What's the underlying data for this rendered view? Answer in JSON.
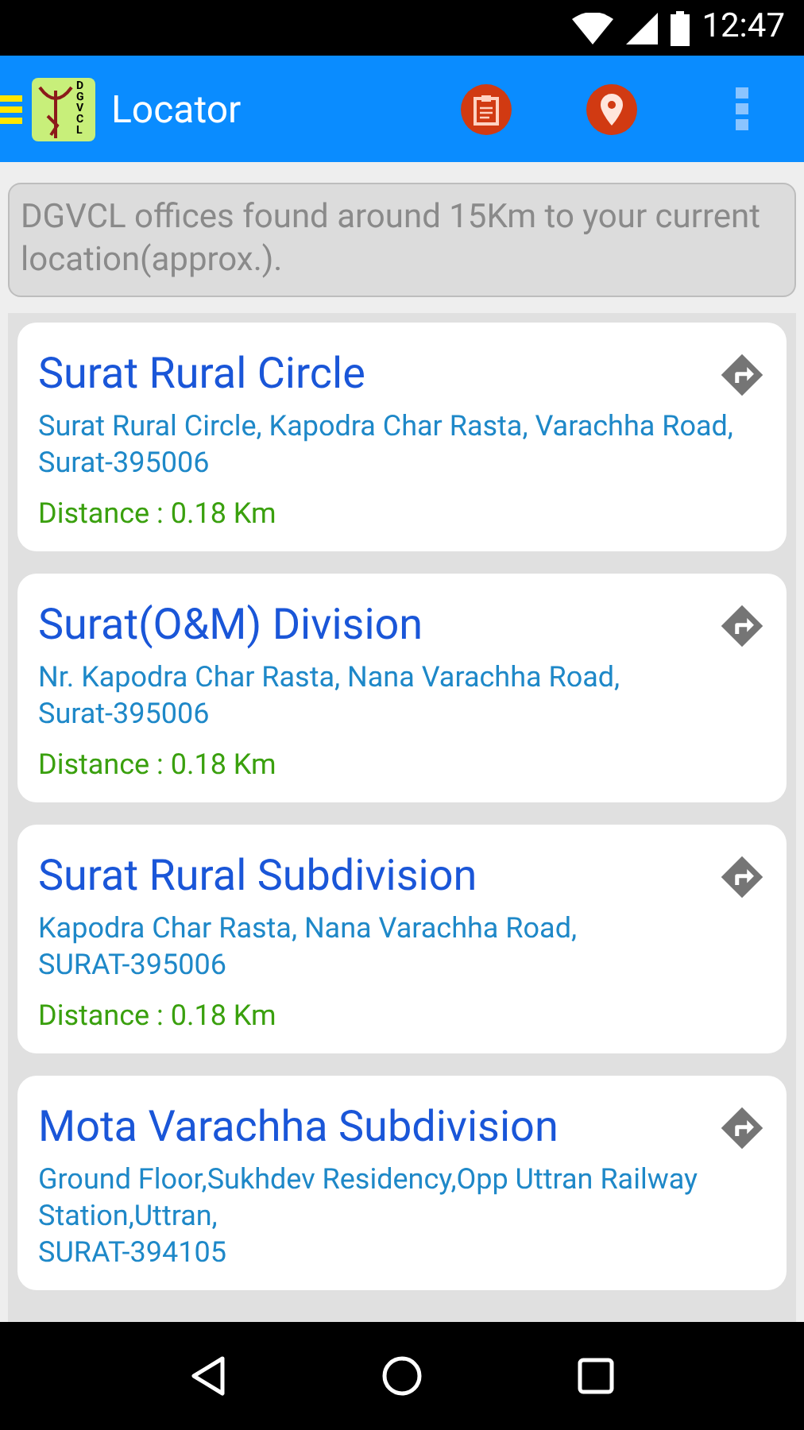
{
  "status_bar": {
    "time": "12:47"
  },
  "app_bar": {
    "title": "Locator",
    "logo_letters": [
      "D",
      "G",
      "V",
      "C",
      "L"
    ]
  },
  "notice": "DGVCL offices found around 15Km to your current location(approx.).",
  "offices": [
    {
      "name": "Surat Rural Circle",
      "address": [
        "Surat Rural Circle, Kapodra Char Rasta, Varachha Road,",
        "Surat-395006"
      ],
      "distance": "Distance : 0.18 Km"
    },
    {
      "name": "Surat(O&M) Division",
      "address": [
        "Nr. Kapodra Char Rasta, Nana Varachha Road,",
        "Surat-395006"
      ],
      "distance": "Distance : 0.18 Km"
    },
    {
      "name": "Surat Rural Subdivision",
      "address": [
        "Kapodra Char Rasta, Nana Varachha Road,",
        "SURAT-395006"
      ],
      "distance": "Distance : 0.18 Km"
    },
    {
      "name": "Mota Varachha Subdivision",
      "address": [
        "Ground Floor,Sukhdev Residency,Opp Uttran Railway Station,Uttran,",
        "SURAT-394105"
      ]
    }
  ]
}
